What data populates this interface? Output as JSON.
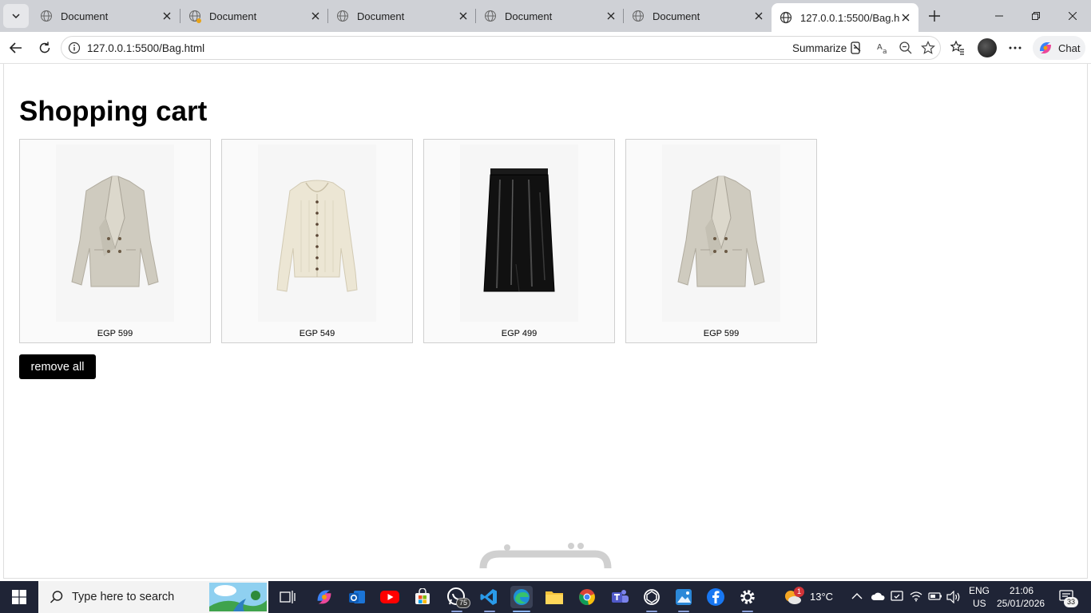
{
  "browser": {
    "tabs": [
      {
        "title": "Document"
      },
      {
        "title": "Document"
      },
      {
        "title": "Document"
      },
      {
        "title": "Document"
      },
      {
        "title": "Document"
      },
      {
        "title": "127.0.0.1:5500/Bag.html",
        "active": true
      }
    ],
    "url": "127.0.0.1:5500/Bag.html",
    "summarize_label": "Summarize",
    "chat_label": "Chat"
  },
  "page": {
    "title": "Shopping cart",
    "products": [
      {
        "image": "beige-blazer",
        "price": "EGP 599"
      },
      {
        "image": "cream-cardigan",
        "price": "EGP 549"
      },
      {
        "image": "black-leather-skirt",
        "price": "EGP 499"
      },
      {
        "image": "beige-blazer",
        "price": "EGP 599"
      }
    ],
    "remove_all_label": "remove all"
  },
  "taskbar": {
    "search_placeholder": "Type here to search",
    "whatsapp_badge": "75",
    "weather_badge": "1",
    "temperature": "13°C",
    "language": "ENG",
    "region": "US",
    "time": "21:06",
    "date": "25/01/2026",
    "notifications": "33"
  },
  "colors": {
    "tabstrip": "#cfd1d6",
    "taskbar": "#1f2436",
    "button": "#000000"
  }
}
